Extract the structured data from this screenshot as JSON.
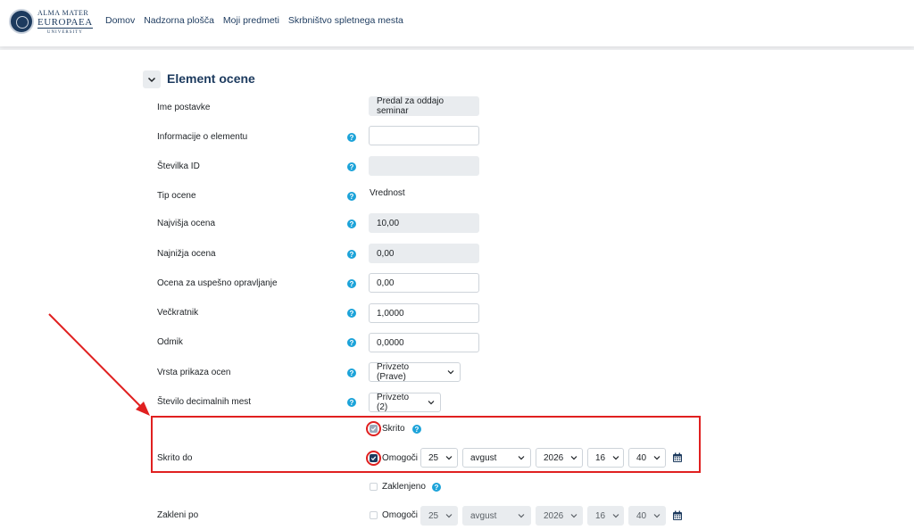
{
  "logo": {
    "line1": "ALMA MATER",
    "line2": "EUROPAEA",
    "line3": "UNIVERSITY"
  },
  "nav": [
    "Domov",
    "Nadzorna plošča",
    "Moji predmeti",
    "Skrbništvo spletnega mesta"
  ],
  "section": {
    "title": "Element ocene"
  },
  "fields": {
    "item_name": {
      "label": "Ime postavke",
      "value": "Predal za oddajo seminar"
    },
    "item_info": {
      "label": "Informacije o elementu",
      "value": ""
    },
    "id_number": {
      "label": "Številka ID",
      "value": ""
    },
    "grade_type": {
      "label": "Tip ocene",
      "value": "Vrednost"
    },
    "max_grade": {
      "label": "Najvišja ocena",
      "value": "10,00"
    },
    "min_grade": {
      "label": "Najnižja ocena",
      "value": "0,00"
    },
    "pass_grade": {
      "label": "Ocena za uspešno opravljanje",
      "value": "0,00"
    },
    "multiplier": {
      "label": "Večkratnik",
      "value": "1,0000"
    },
    "offset": {
      "label": "Odmik",
      "value": "0,0000"
    },
    "display_type": {
      "label": "Vrsta prikaza ocen",
      "value": "Privzeto (Prave)"
    },
    "decimals": {
      "label": "Število decimalnih mest",
      "value": "Privzeto (2)"
    }
  },
  "hidden": {
    "label": "Skrito",
    "checked": true
  },
  "hidden_until": {
    "label": "Skrito do",
    "enable_label": "Omogoči",
    "enabled": true,
    "day": "25",
    "month": "avgust",
    "year": "2026",
    "hour": "16",
    "minute": "40"
  },
  "locked": {
    "label": "Zaklenjeno",
    "checked": false
  },
  "lock_after": {
    "label": "Zakleni po",
    "enable_label": "Omogoči",
    "enabled": false,
    "day": "25",
    "month": "avgust",
    "year": "2026",
    "hour": "16",
    "minute": "40"
  },
  "help_glyph": "?",
  "icons": {
    "help": "help-icon",
    "calendar": "calendar-icon",
    "caret": "chevron-down-icon",
    "check": "check-icon"
  },
  "colors": {
    "brand": "#1c3a5e",
    "help": "#1ca3d9",
    "annotation": "#e02020"
  }
}
